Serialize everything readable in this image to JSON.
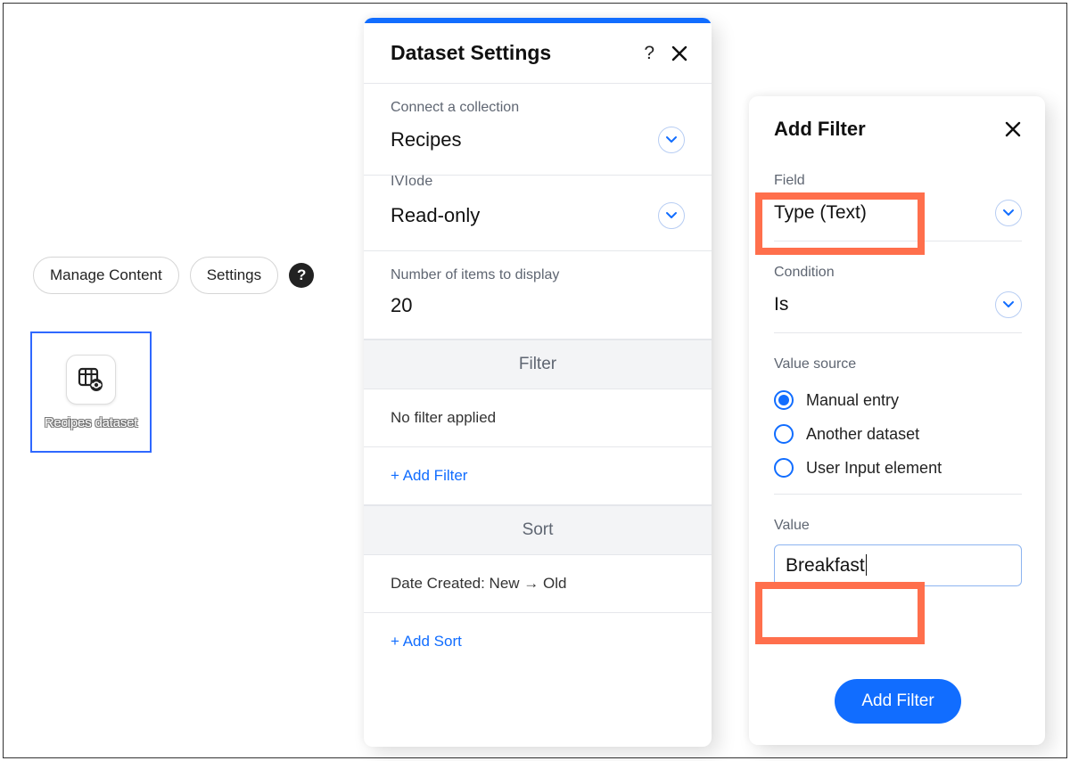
{
  "toolbar": {
    "manage_content": "Manage Content",
    "settings": "Settings"
  },
  "dataset_element": {
    "label": "Recipes dataset"
  },
  "settings_panel": {
    "title": "Dataset Settings",
    "connect_label": "Connect a collection",
    "connect_value": "Recipes",
    "mode_label_clipped": "Mode",
    "mode_value": "Read-only",
    "items_label": "Number of items to display",
    "items_value": "20",
    "filter_heading": "Filter",
    "filter_status": "No filter applied",
    "add_filter": "+ Add Filter",
    "sort_heading": "Sort",
    "sort_status": "Date Created: New → Old",
    "add_sort": "+ Add Sort"
  },
  "filter_panel": {
    "title": "Add Filter",
    "field_label": "Field",
    "field_value": "Type (Text)",
    "condition_label": "Condition",
    "condition_value": "Is",
    "value_source_label": "Value source",
    "value_source_options": {
      "manual": "Manual entry",
      "another": "Another dataset",
      "input_el": "User Input element"
    },
    "value_source_selected": "manual",
    "value_label": "Value",
    "value_input": "Breakfast",
    "submit": "Add Filter"
  },
  "icons": {
    "chevron_down": "chevron-down-icon",
    "close": "close-icon",
    "help": "?"
  }
}
